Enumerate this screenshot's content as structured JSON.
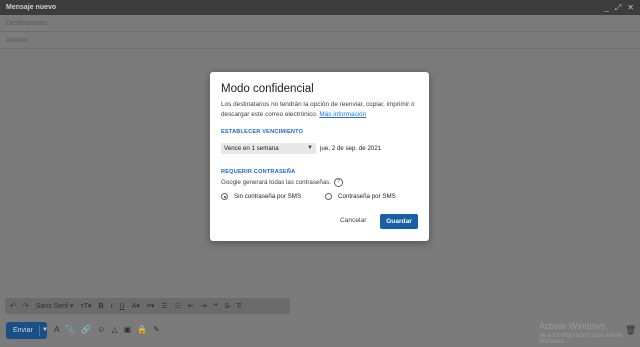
{
  "window": {
    "title": "Mensaje nuevo",
    "controls": [
      "_",
      "⤢",
      "✕"
    ]
  },
  "fields": {
    "to_placeholder": "Destinatarios",
    "subject_placeholder": "Asunto"
  },
  "dialog": {
    "title": "Modo confidencial",
    "description": "Los destinatarios no tendrán la opción de reenviar, copiar, imprimir o descargar este correo electrónico.",
    "more_info": "Más información",
    "expiry_label": "ESTABLECER VENCIMIENTO",
    "expiry_value": "Vence en 1 semana",
    "expiry_date": "jue, 2 de sep. de 2021",
    "password_label": "REQUERIR CONTRASEÑA",
    "generate_text": "Google generará todas las contraseñas.",
    "radio_no_sms": "Sin contraseña por SMS",
    "radio_sms": "Contraseña por SMS",
    "cancel": "Cancelar",
    "save": "Guardar"
  },
  "toolbar": {
    "font": "Sans Serif",
    "items": [
      "↶",
      "↷",
      "Sans Serif ▾",
      "ᴛT▾",
      "B",
      "I",
      "U",
      "A▾",
      "≡▾",
      "☰",
      "☷",
      "⇤",
      "⇥",
      "❝",
      "S̶",
      "T̸"
    ]
  },
  "bottom": {
    "send": "Enviar",
    "icons": [
      "A",
      "📎",
      "🔗",
      "☺",
      "△",
      "▣",
      "🔒",
      "✎"
    ],
    "watermark_line1": "Activar Windows",
    "watermark_line2": "Ve a Configuración para activar Windows."
  }
}
